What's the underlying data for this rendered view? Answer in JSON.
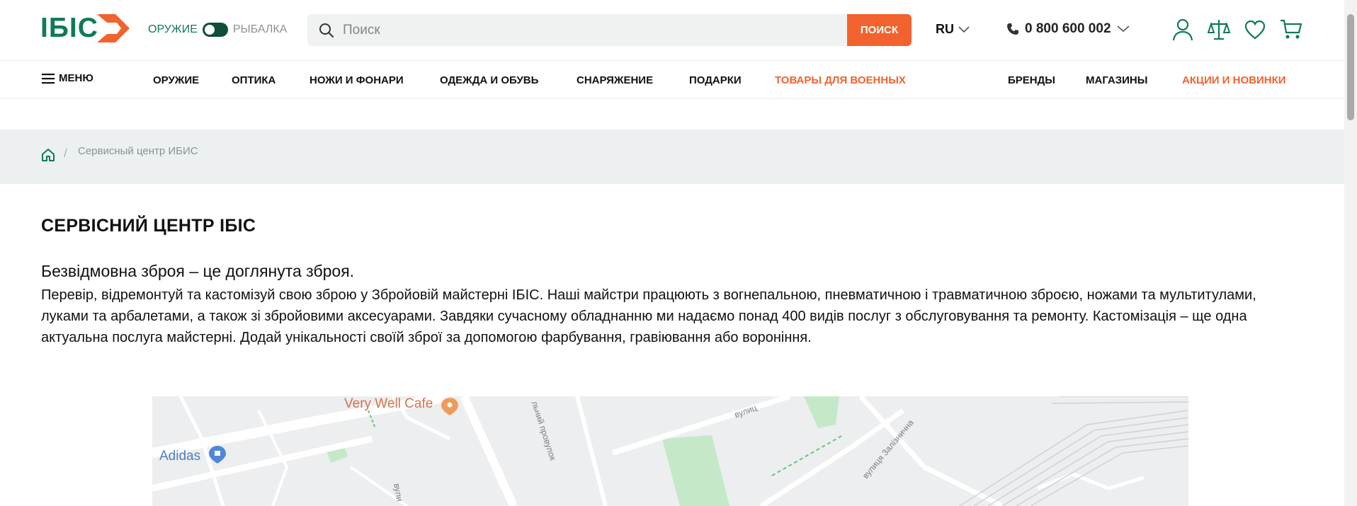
{
  "header": {
    "logo_text": "ІБІС",
    "mode_left": "ОРУЖИЕ",
    "mode_right": "РЫБАЛКА",
    "search_placeholder": "Поиск",
    "search_button": "ПОИСК",
    "language": "RU",
    "phone": "0 800 600 002",
    "icons": [
      "user-icon",
      "compare-scales-icon",
      "heart-icon",
      "cart-icon"
    ]
  },
  "nav": {
    "menu_label": "МЕНЮ",
    "items": [
      {
        "label": "ОРУЖИЕ"
      },
      {
        "label": "ОПТИКА"
      },
      {
        "label": "НОЖИ И ФОНАРИ"
      },
      {
        "label": "ОДЕЖДА И ОБУВЬ"
      },
      {
        "label": "СНАРЯЖЕНИЕ"
      },
      {
        "label": "ПОДАРКИ"
      },
      {
        "label": "ТОВАРЫ ДЛЯ ВОЕННЫХ"
      },
      {
        "label": "БРЕНДЫ"
      },
      {
        "label": "МАГАЗИНЫ"
      },
      {
        "label": "АКЦИИ И НОВИНКИ"
      }
    ]
  },
  "breadcrumb": {
    "separator": "/",
    "current": "Сервисный центр ИБИС"
  },
  "content": {
    "title": "СЕРВІСНИЙ ЦЕНТР ІБІС",
    "lead": "Безвідмовна зброя – це доглянута зброя.",
    "body": "Перевір, відремонтуй та кастомізуй свою зброю у Збройовій майстерні ІБІС. Наші майстри працюють з вогнепальною, пневматичною і травматичною зброєю, ножами та мультитулами, луками та арбалетами, а також зі збройовими аксесуарами.  Завдяки сучасному обладнанню ми надаємо понад 400 видів послуг з обслуговування та ремонту. Кастомізація – ще одна актуальна послуга майстерні. Додай унікальності своїй зброї за допомогою фарбування, гравіювання або вороніння."
  },
  "map": {
    "poi_cafe": "Very Well Cafe",
    "poi_adidas": "Adidas",
    "street_1": "вулиця Залізнична",
    "street_2": "льний провулок",
    "street_3": "вулиц",
    "street_4": "вули"
  },
  "colors": {
    "brand_green": "#0f7a56",
    "accent_orange": "#f2622e",
    "breadcrumb_bg": "#edf0f0"
  }
}
